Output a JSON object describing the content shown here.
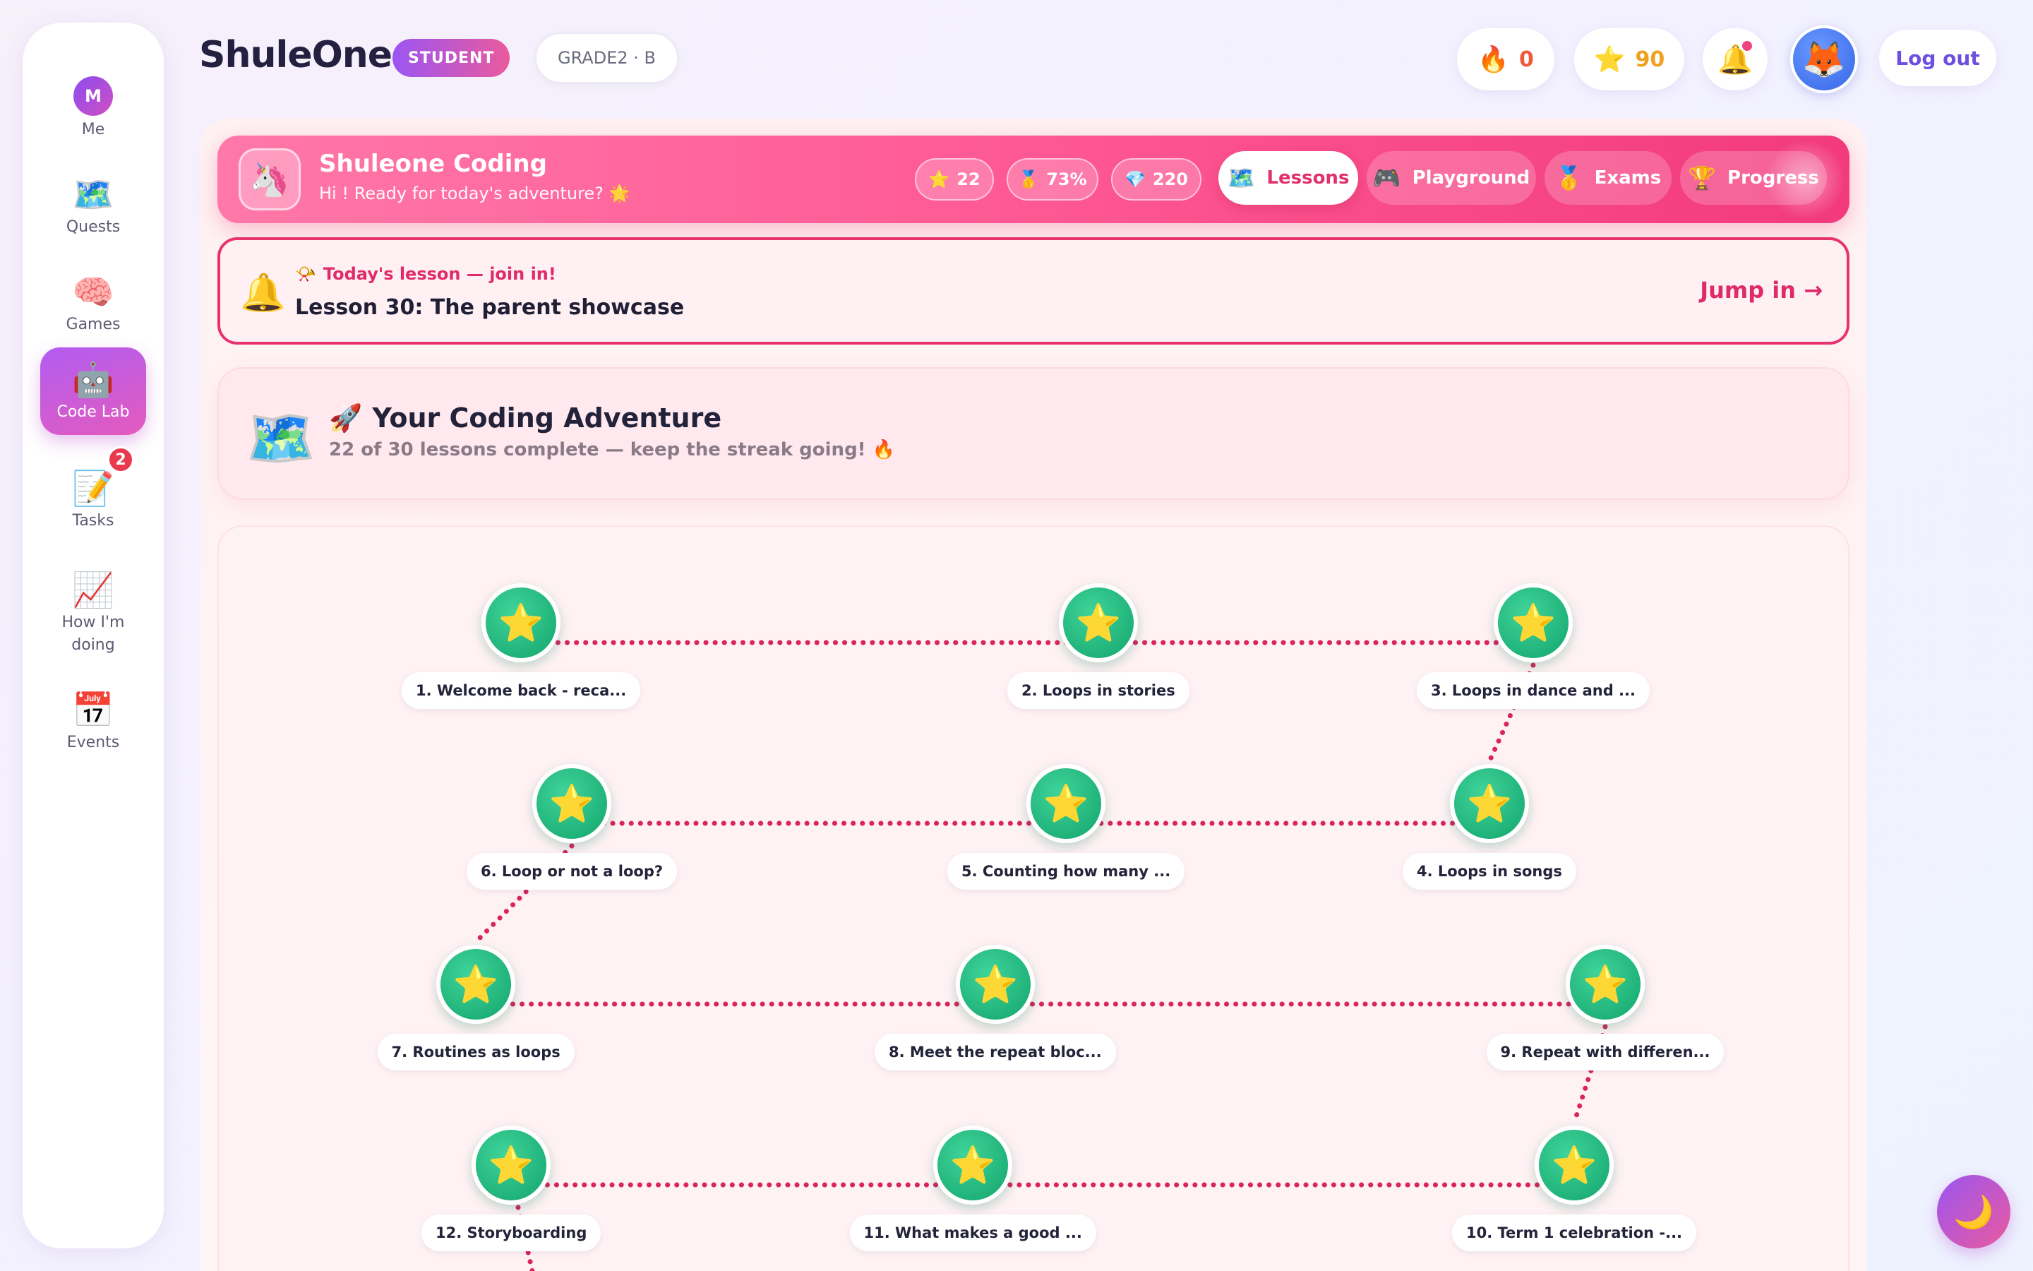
{
  "sidebar": {
    "me": {
      "initial": "M",
      "label": "Me"
    },
    "items": [
      {
        "icon": "🗺️",
        "label": "Quests",
        "icon_name": "map-icon"
      },
      {
        "icon": "🧠",
        "label": "Games",
        "icon_name": "brain-icon"
      },
      {
        "icon": "🤖",
        "label": "Code Lab",
        "icon_name": "robot-icon",
        "active": true
      },
      {
        "icon": "📝",
        "label": "Tasks",
        "icon_name": "memo-icon",
        "badge": "2"
      },
      {
        "icon": "📈",
        "label": "How I'm doing",
        "icon_name": "chart-icon"
      },
      {
        "icon": "📅",
        "label": "Events",
        "icon_name": "calendar-icon"
      }
    ]
  },
  "header": {
    "brand": "ShuleOne",
    "role": "STUDENT",
    "grade": "GRADE2 · B",
    "streak": {
      "icon": "🔥",
      "value": "0",
      "color": "#f05a3a"
    },
    "stars": {
      "icon": "⭐",
      "value": "90",
      "color": "#f0a020"
    },
    "bell_icon": "🔔",
    "avatar_icon": "🦊",
    "logout": "Log out"
  },
  "banner": {
    "icon": "🦄",
    "title": "Shuleone Coding",
    "subtitle": "Hi ! Ready for today's adventure? 🌟",
    "stats": [
      {
        "icon": "⭐",
        "value": "22"
      },
      {
        "icon": "🥇",
        "value": "73%"
      },
      {
        "icon": "💎",
        "value": "220"
      }
    ],
    "tabs": [
      {
        "icon": "🗺️",
        "label": "Lessons",
        "active": true
      },
      {
        "icon": "🎮",
        "label": "Playground"
      },
      {
        "icon": "🥇",
        "label": "Exams"
      },
      {
        "icon": "🏆",
        "label": "Progress"
      }
    ]
  },
  "today": {
    "bell": "🔔",
    "megaphone": "📯",
    "label": "Today's lesson — join in!",
    "title": "Lesson 30: The parent showcase",
    "cta": "Jump in →"
  },
  "adventure": {
    "icon": "🗺️",
    "rocket": "🚀",
    "title": "Your Coding Adventure",
    "subtitle": "22 of 30 lessons complete — keep the streak going! 🔥"
  },
  "lessons": [
    {
      "label": "1. Welcome back - reca...",
      "icon": "⭐"
    },
    {
      "label": "2. Loops in stories",
      "icon": "⭐"
    },
    {
      "label": "3. Loops in dance and ...",
      "icon": "⭐"
    },
    {
      "label": "4. Loops in songs",
      "icon": "⭐"
    },
    {
      "label": "5. Counting how many ...",
      "icon": "⭐"
    },
    {
      "label": "6. Loop or not a loop?",
      "icon": "⭐"
    },
    {
      "label": "7. Routines as loops",
      "icon": "⭐"
    },
    {
      "label": "8. Meet the repeat bloc...",
      "icon": "⭐"
    },
    {
      "label": "9. Repeat with differen...",
      "icon": "⭐"
    },
    {
      "label": "10. Term 1 celebration -...",
      "icon": "⭐"
    },
    {
      "label": "11. What makes a good ...",
      "icon": "⭐"
    },
    {
      "label": "12. Storyboarding",
      "icon": "⭐"
    }
  ],
  "theme": {
    "accent": "#e8326f",
    "path_color": "#d9245f",
    "node_color": "#1fb87e"
  },
  "moon_icon": "🌙"
}
